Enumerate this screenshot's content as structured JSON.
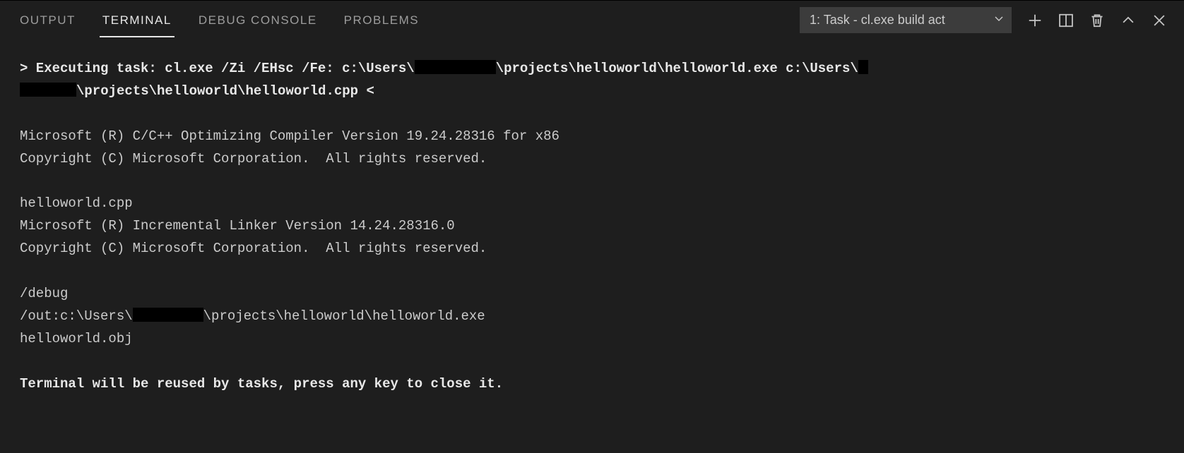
{
  "tabs": {
    "output": "OUTPUT",
    "terminal": "TERMINAL",
    "debug_console": "DEBUG CONSOLE",
    "problems": "PROBLEMS"
  },
  "dropdown": {
    "label": "1: Task - cl.exe build act"
  },
  "term": {
    "exec_prefix": "> Executing task: cl.exe /Zi /EHsc /Fe: c:\\Users\\",
    "exec_mid1": "\\projects\\helloworld\\helloworld.exe c:\\Users\\",
    "exec_mid2": "\\projects\\helloworld\\helloworld.cpp <",
    "compiler1": "Microsoft (R) C/C++ Optimizing Compiler Version 19.24.28316 for x86",
    "copyright": "Copyright (C) Microsoft Corporation.  All rights reserved.",
    "srcfile": "helloworld.cpp",
    "linker": "Microsoft (R) Incremental Linker Version 14.24.28316.0",
    "debugflag": "/debug",
    "out_prefix": "/out:c:\\Users\\",
    "out_suffix": "\\projects\\helloworld\\helloworld.exe",
    "obj": "helloworld.obj",
    "reuse": "Terminal will be reused by tasks, press any key to close it."
  }
}
